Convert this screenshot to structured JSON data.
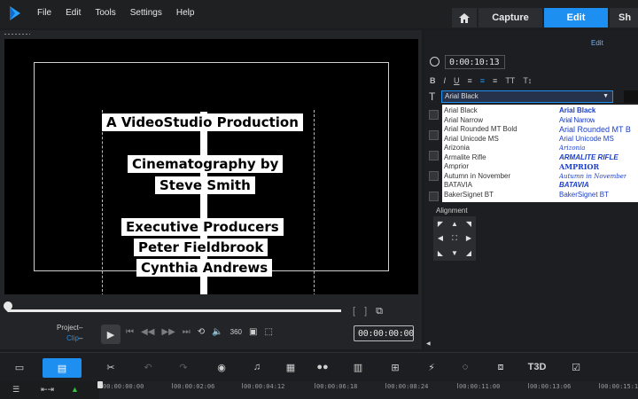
{
  "menu": [
    {
      "label": "File"
    },
    {
      "label": "Edit"
    },
    {
      "label": "Tools"
    },
    {
      "label": "Settings"
    },
    {
      "label": "Help"
    }
  ],
  "tabs": {
    "capture": "Capture",
    "edit": "Edit",
    "share": "Sh"
  },
  "preview": {
    "credits": [
      "A VideoStudio Production",
      "Cinematography by",
      "Steve Smith",
      "Executive Producers",
      "Peter Fieldbrook",
      "Cynthia Andrews"
    ]
  },
  "player": {
    "mode_project": "Project",
    "mode_clip": "Clip",
    "timecode": "00:00:00:00",
    "scrub_position": 0.0
  },
  "options": {
    "panel_label": "Edit",
    "duration": "0:00:10:13",
    "format_buttons": [
      "B",
      "I",
      "U",
      "≡",
      "≡",
      "≡",
      "TT",
      "T↕"
    ],
    "selected_font": "Arial Black",
    "fonts": [
      {
        "name": "Arial Black",
        "preview": "Arial Black"
      },
      {
        "name": "Arial Narrow",
        "preview": "Arial Narrow"
      },
      {
        "name": "Arial Rounded MT Bold",
        "preview": "Arial Rounded MT B"
      },
      {
        "name": "Arial Unicode MS",
        "preview": "Arial Unicode MS"
      },
      {
        "name": "Arizonia",
        "preview": "Arizonia"
      },
      {
        "name": "Armalite Rifle",
        "preview": "ARMALITE RIFLE"
      },
      {
        "name": "Amprior",
        "preview": "AMPRIOR"
      },
      {
        "name": "Autumn in November",
        "preview": "Autumn in November"
      },
      {
        "name": "BATAVIA",
        "preview": "BATAVIA"
      },
      {
        "name": "BakerSignet BT",
        "preview": "BakerSignet BT"
      }
    ],
    "alignment_label": "Alignment"
  },
  "timeline": {
    "ticks": [
      "00:00:00:00",
      "00:00:02:06",
      "00:00:04:12",
      "00:00:06:18",
      "00:00:08:24",
      "00:00:11:00",
      "00:00:13:06",
      "00:00:15:1"
    ]
  },
  "colors": {
    "accent": "#1d8ff0",
    "panel": "#232427",
    "preview_bg": "#000000"
  },
  "icons": {
    "logo": "videostudio-logo-icon",
    "home": "home-icon",
    "play": "play-icon"
  }
}
